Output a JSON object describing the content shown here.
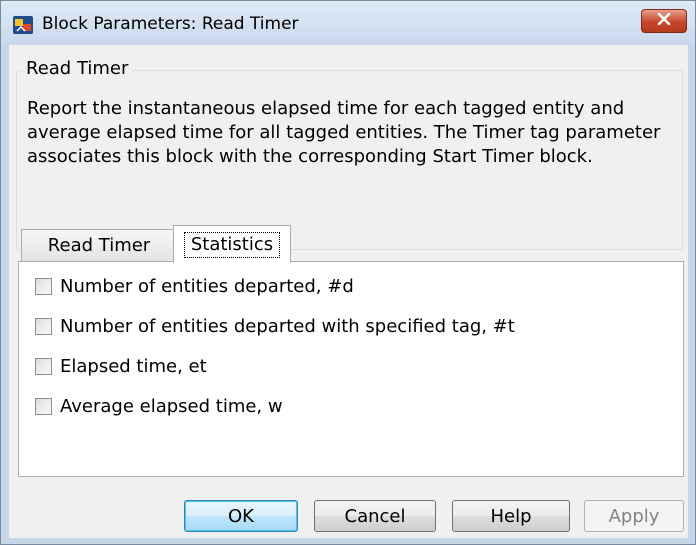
{
  "window": {
    "title": "Block Parameters: Read Timer"
  },
  "group": {
    "title": "Read Timer",
    "description": "Report the instantaneous elapsed time for each tagged entity and average elapsed time for all tagged entities. The Timer tag parameter associates this block with the corresponding Start Timer block."
  },
  "tabs": [
    {
      "label": "Read Timer",
      "selected": false
    },
    {
      "label": "Statistics",
      "selected": true
    }
  ],
  "statistics": {
    "options": [
      {
        "label": "Number of entities departed, #d",
        "checked": false
      },
      {
        "label": "Number of entities departed with specified tag, #t",
        "checked": false
      },
      {
        "label": "Elapsed time, et",
        "checked": false
      },
      {
        "label": "Average elapsed time, w",
        "checked": false
      }
    ]
  },
  "buttons": {
    "ok": "OK",
    "cancel": "Cancel",
    "help": "Help",
    "apply": "Apply"
  },
  "colors": {
    "accent_close": "#c7462a",
    "default_button_border": "#3c7fb1",
    "disabled_text": "#838383"
  },
  "icons": {
    "app": "simulink-block-icon",
    "close": "close-icon"
  }
}
